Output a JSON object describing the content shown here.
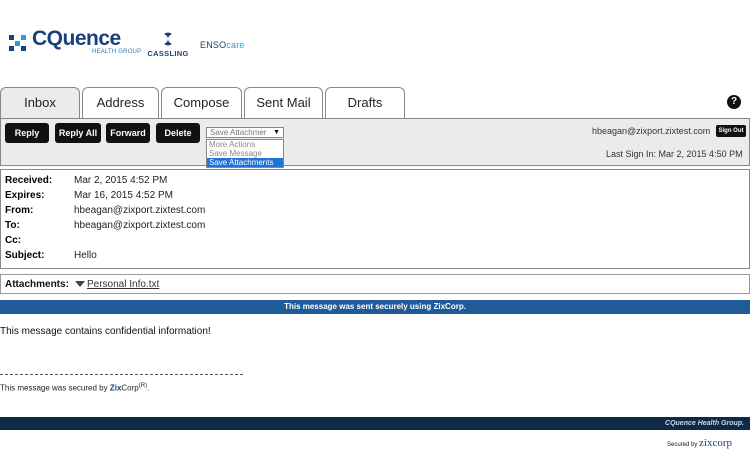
{
  "branding": {
    "cquence_name": "CQuence",
    "cquence_sub": "HEALTH GROUP",
    "cassling": "CASSLING",
    "enso_a": "ENSO",
    "enso_b": "care"
  },
  "tabs": [
    {
      "label": "Inbox",
      "active": true
    },
    {
      "label": "Address",
      "active": false
    },
    {
      "label": "Compose",
      "active": false
    },
    {
      "label": "Sent Mail",
      "active": false
    },
    {
      "label": "Drafts",
      "active": false
    }
  ],
  "help_icon": "?",
  "toolbar": {
    "reply": "Reply",
    "reply_all": "Reply All",
    "forward": "Forward",
    "delete": "Delete",
    "select_value": "Save Attachmer",
    "dropdown_options": [
      "More Actions",
      "Save Message",
      "Save Attachments"
    ],
    "dropdown_selected": "Save Attachments",
    "user_email": "hbeagan@zixport.zixtest.com",
    "sign_out": "Sign Out",
    "last_signin": "Last Sign In: Mar 2, 2015 4:50 PM"
  },
  "headers": [
    {
      "label": "Received:",
      "value": "Mar 2, 2015 4:52 PM"
    },
    {
      "label": "Expires:",
      "value": "Mar 16, 2015 4:52 PM"
    },
    {
      "label": "From:",
      "value": "hbeagan@zixport.zixtest.com"
    },
    {
      "label": "To:",
      "value": "hbeagan@zixport.zixtest.com"
    },
    {
      "label": "Cc:",
      "value": ""
    },
    {
      "label": "Subject:",
      "value": "Hello"
    }
  ],
  "attachments": {
    "label": "Attachments:",
    "file": "Personal Info.txt"
  },
  "banner": "This message was sent securely using ZixCorp.",
  "body_text": "This message contains confidential information!",
  "secured_note": {
    "prefix": "This message was secured by ",
    "zix": "Zix",
    "corp": "Corp",
    "reg": "(R)",
    "suffix": "."
  },
  "footer_text": "CQuence Health Group.",
  "secured_by": {
    "label": "Secured by ",
    "brand": "zixcorp"
  },
  "colors": {
    "banner": "#1f5c97",
    "footer": "#0f2a47",
    "selection": "#1e73d6"
  }
}
